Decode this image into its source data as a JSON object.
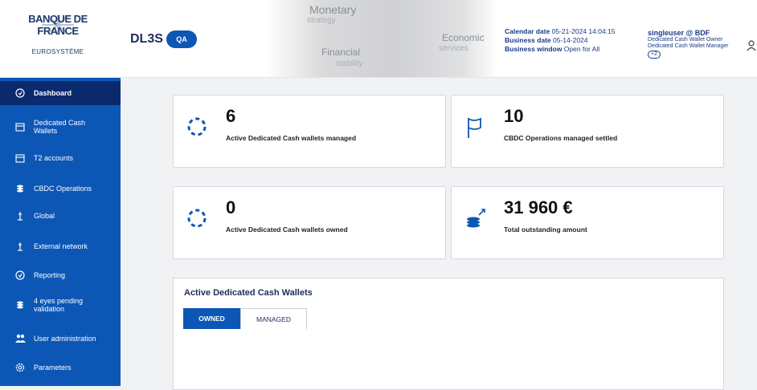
{
  "header": {
    "logo": {
      "bank": "BANQUE DE FRANCE",
      "euro": "EUROSYSTÈME"
    },
    "app_name": "DL3S",
    "env_badge": "QA",
    "banner": {
      "monetary": "Monetary",
      "strategy": "strategy",
      "economic": "Economic",
      "services": "services",
      "financial": "Financial",
      "stability": "stability"
    },
    "calendar_date_label": "Calendar date",
    "calendar_date": "05-21-2024 14:04:15",
    "business_date_label": "Business date",
    "business_date": "05-14-2024",
    "business_window_label": "Business window",
    "business_window": "Open for All",
    "user": {
      "name": "singleuser @ BDF",
      "role1": "Dedicated Cash Wallet Owner",
      "role2": "Dedicated Cash Wallet Manager",
      "more": "+2"
    }
  },
  "sidebar": {
    "items": [
      {
        "label": "Dashboard",
        "icon": "dashboard-icon"
      },
      {
        "label": "Dedicated Cash",
        "label2": "Wallets",
        "icon": "wallet-icon"
      },
      {
        "label": "T2 accounts",
        "icon": "wallet-icon"
      },
      {
        "label": "CBDC Operations",
        "icon": "coins-icon"
      },
      {
        "label": "Global",
        "icon": "global-icon"
      },
      {
        "label": "External network",
        "icon": "network-icon"
      },
      {
        "label": "Reporting",
        "icon": "reporting-icon"
      },
      {
        "label": "4 eyes pending",
        "label2": "validation",
        "icon": "coins-icon"
      },
      {
        "label": "User administration",
        "icon": "users-icon"
      },
      {
        "label": "Parameters",
        "icon": "gear-icon"
      }
    ]
  },
  "cards": [
    {
      "value": "6",
      "label": "Active Dedicated Cash wallets managed",
      "icon": "spinner-icon"
    },
    {
      "value": "10",
      "label": "CBDC Operations managed settled",
      "icon": "flag-icon"
    },
    {
      "value": "0",
      "label": "Active Dedicated Cash wallets owned",
      "icon": "spinner-icon"
    },
    {
      "value": "31 960 €",
      "label": "Total outstanding amount",
      "icon": "coins-growth-icon"
    }
  ],
  "wallets_panel": {
    "title": "Active Dedicated Cash Wallets",
    "tabs": [
      "OWNED",
      "MANAGED"
    ]
  },
  "colors": {
    "primary": "#0c57b6",
    "sidebar_active": "#0a2a6e",
    "text_dark": "#1b2e5a"
  }
}
